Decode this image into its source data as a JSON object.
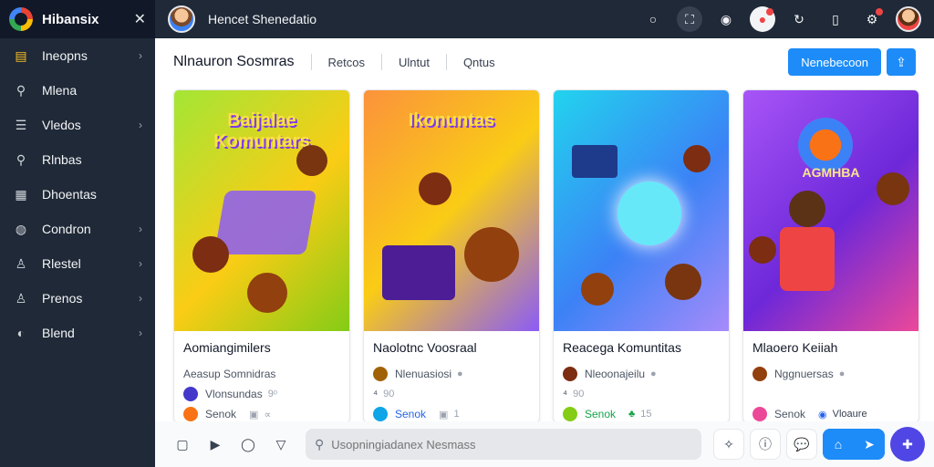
{
  "app": {
    "name": "Hibansix",
    "close_icon": "close-icon"
  },
  "sidebar": {
    "items": [
      {
        "label": "Ineopns",
        "icon": "folder-icon",
        "chevron": true,
        "active": true
      },
      {
        "label": "Mlena",
        "icon": "search-icon",
        "chevron": false
      },
      {
        "label": "Vledos",
        "icon": "sliders-icon",
        "chevron": true
      },
      {
        "label": "Rlnbas",
        "icon": "search-icon",
        "chevron": false
      },
      {
        "label": "Dhoentas",
        "icon": "list-icon",
        "chevron": false
      },
      {
        "label": "Condron",
        "icon": "globe-icon",
        "chevron": true
      },
      {
        "label": "Rlestel",
        "icon": "user-icon",
        "chevron": true
      },
      {
        "label": "Prenos",
        "icon": "user-icon",
        "chevron": true
      },
      {
        "label": "Blend",
        "icon": "palette-icon",
        "chevron": true
      }
    ]
  },
  "topbar": {
    "title": "Hencet Shenedatio",
    "icons": [
      "circle-icon",
      "expand-icon",
      "chat-icon",
      "notification-icon",
      "refresh-icon",
      "panel-icon",
      "settings-icon",
      "profile-avatar"
    ]
  },
  "main": {
    "title": "Nlnauron Sosmras",
    "tabs": [
      "Retcos",
      "Ulntut",
      "Qntus"
    ],
    "primary_button": "Nenebecoon",
    "cards": [
      {
        "thumb_text": "Baijalae Komuntars",
        "gradient": [
          "#a3e635",
          "#facc15",
          "#84cc16"
        ],
        "title": "Aomiangimilers",
        "subtitle": "Aeasup Somnidras",
        "author": "Vlonsundas",
        "author_extra": "9ᵒ",
        "stat_a": "Senok",
        "stat_b": "∝"
      },
      {
        "thumb_text": "Ikonuntas",
        "gradient": [
          "#fb923c",
          "#facc15",
          "#8b5cf6"
        ],
        "title": "Naolotnc Voosraal",
        "subtitle": "Nlenuasiosi",
        "author": "⁴",
        "author_extra": "90",
        "stat_a": "Senok",
        "stat_b": "1"
      },
      {
        "thumb_text": "",
        "gradient": [
          "#22d3ee",
          "#3b82f6",
          "#a78bfa"
        ],
        "title": "Reacega Komuntitas",
        "subtitle": "Nleoonajeilu",
        "author": "⁴",
        "author_extra": "90",
        "stat_a": "Senok",
        "stat_b": "15"
      },
      {
        "thumb_text": "AGMHBA",
        "gradient": [
          "#a855f7",
          "#6d28d9",
          "#ec4899"
        ],
        "title": "Mlaoero Keiiah",
        "subtitle": "Nggnuersas",
        "author": "",
        "author_extra": "",
        "stat_a": "Senok",
        "stat_b": "Vloaure"
      }
    ]
  },
  "bottom": {
    "search_placeholder": "Usopningiadanex Nesmass",
    "left_icons": [
      "square-icon",
      "play-icon",
      "chat-bubble-icon",
      "triangle-icon"
    ],
    "right_icons": [
      "magic-icon",
      "info-icon",
      "comment-icon",
      "home-icon",
      "send-icon",
      "add-icon"
    ]
  }
}
